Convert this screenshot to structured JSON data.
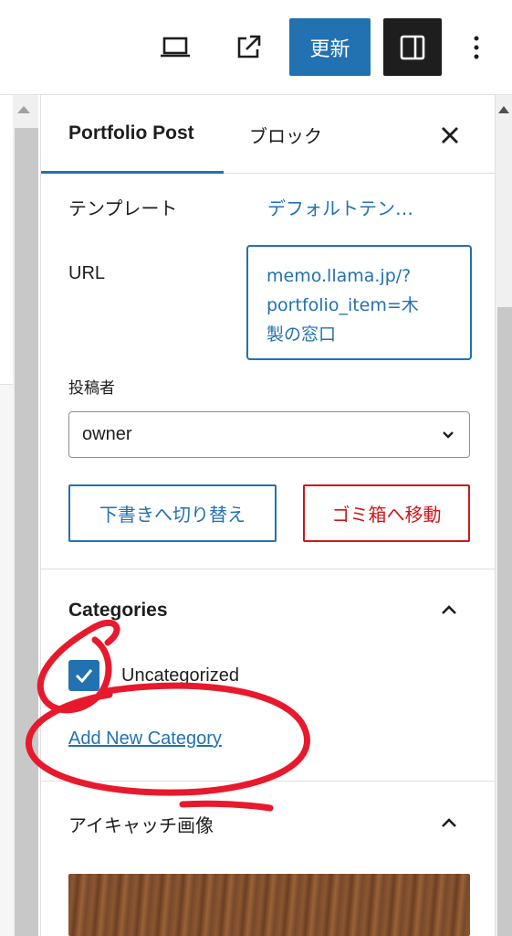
{
  "toolbar": {
    "preview_icon": "laptop-icon",
    "view_post_icon": "external-link-icon",
    "update_label": "更新",
    "settings_icon": "sidebar-toggle-icon",
    "more_icon": "vertical-dots-icon",
    "accent_color": "#2271b1"
  },
  "sidebar": {
    "tabs": [
      {
        "label": "Portfolio Post",
        "active": true
      },
      {
        "label": "ブロック",
        "active": false
      }
    ],
    "close_icon": "close-icon",
    "template": {
      "label": "テンプレート",
      "value": "デフォルトテン…"
    },
    "url": {
      "label": "URL",
      "line1": "memo.llama.jp/?",
      "line2": "portfolio_item=木",
      "line3": "製の窓口"
    },
    "author": {
      "label": "投稿者",
      "selected": "owner"
    },
    "buttons": {
      "draft": "下書きへ切り替え",
      "trash": "ゴミ箱へ移動"
    },
    "categories": {
      "title": "Categories",
      "items": [
        {
          "label": "Uncategorized",
          "checked": true
        }
      ],
      "add_new": "Add New Category"
    },
    "featured_image": {
      "title": "アイキャッチ画像"
    }
  },
  "annotation_color": "#e8192c"
}
